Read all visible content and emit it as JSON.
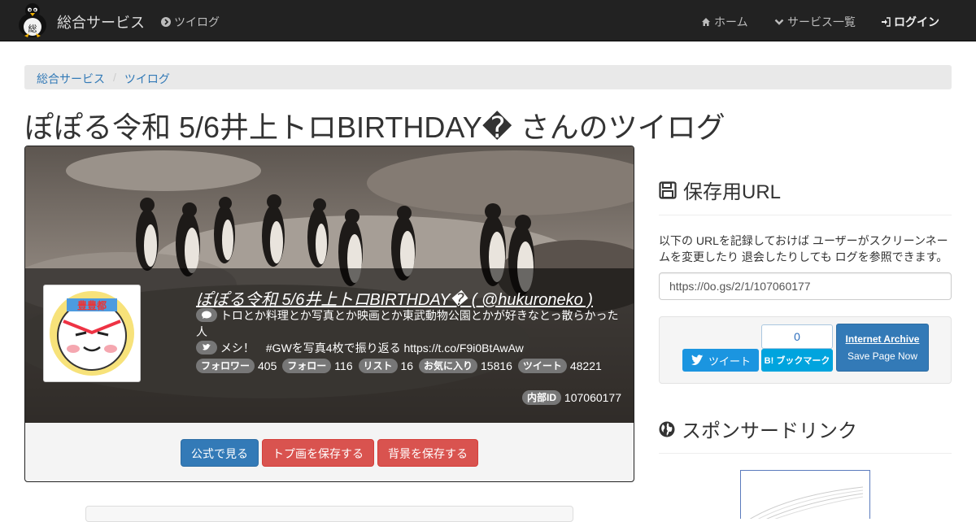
{
  "navbar": {
    "brand": "総合サービス",
    "twilog_link": "ツイログ",
    "home": "ホーム",
    "services": "サービス一覧",
    "login": "ログイン"
  },
  "breadcrumb": {
    "root": "総合サービス",
    "current": "ツイログ"
  },
  "page_title": "ぽぽる令和 5/6井上トロBIRTHDAY� さんのツイログ",
  "profile": {
    "name_link": "ぽぽる令和 5/6井上トロBIRTHDAY� ( @hukuroneko )",
    "bio": "トロとか料理とか写真とか映画とか東武動物公園とかが好きなとっ散らかった人",
    "pinned_tweet": "メシ！　#GWを写真4枚で振り返る https://t.co/F9i0BtAwAw",
    "stats": [
      {
        "label": "フォロワー",
        "value": "405"
      },
      {
        "label": "フォロー",
        "value": "116"
      },
      {
        "label": "リスト",
        "value": "16"
      },
      {
        "label": "お気に入り",
        "value": "15816"
      },
      {
        "label": "ツイート",
        "value": "48221"
      }
    ],
    "internal_id_label": "内部ID",
    "internal_id": "107060177",
    "avatar_text": "豊豊都"
  },
  "card_buttons": {
    "official": "公式で見る",
    "save_icon": "トプ画を保存する",
    "save_banner": "背景を保存する"
  },
  "save_url": {
    "heading": "保存用URL",
    "description": "以下の URLを記録しておけば ユーザーがスクリーンネームを変更したり 退会したりしても ログを参照できます。",
    "url": "https://0o.gs/2/1/107060177"
  },
  "share": {
    "tweet": "ツイート",
    "hatena_count": "0",
    "hatena_label": "B! ブックマーク",
    "ia_title": "Internet Archive",
    "ia_sub": "Save Page Now"
  },
  "sponsored": {
    "heading": "スポンサードリンク"
  },
  "colors": {
    "navbar": "#222222",
    "primary": "#337ab7",
    "danger": "#d9534f",
    "twitter": "#1b95e0",
    "hatena": "#00a4de"
  }
}
